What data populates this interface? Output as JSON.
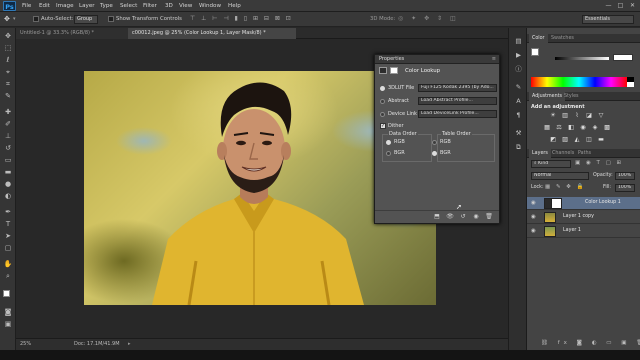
{
  "app": {
    "logo": "Ps"
  },
  "menu": [
    "File",
    "Edit",
    "Image",
    "Layer",
    "Type",
    "Select",
    "Filter",
    "3D",
    "View",
    "Window",
    "Help"
  ],
  "window_controls": {
    "minimize": "—",
    "maximize": "□",
    "close": "✕"
  },
  "options_bar": {
    "auto_select_label": "Auto-Select:",
    "auto_select_value": "Group",
    "show_transform_label": "Show Transform Controls",
    "mode_3d_label": "3D Mode:",
    "workspace": "Essentials"
  },
  "tabs": [
    {
      "label": "Untitled-1 @ 33.3% (RGB/8) *",
      "active": false
    },
    {
      "label": "c00012.jpeg @ 25% (Color Lookup 1, Layer Mask/8) *",
      "active": true
    }
  ],
  "status": {
    "zoom": "25%",
    "doc": "Doc: 17.1M/41.9M"
  },
  "properties": {
    "panel_tab": "Properties",
    "title": "Color Lookup",
    "rows": [
      {
        "label": "3DLUT File",
        "value": "Fuji F125 Kodak 2395 (by Ado...",
        "selected": true
      },
      {
        "label": "Abstract",
        "value": "Load Abstract Profile...",
        "selected": false
      },
      {
        "label": "Device Link",
        "value": "Load DeviceLink Profile...",
        "selected": false
      }
    ],
    "dither_label": "Dither",
    "data_order": {
      "title": "Data Order",
      "options": [
        "RGB",
        "BGR"
      ],
      "selected": "RGB"
    },
    "table_order": {
      "title": "Table Order",
      "options": [
        "RGB",
        "BGR"
      ],
      "selected": "BGR"
    }
  },
  "right_panels": {
    "color_tabs": [
      "Color",
      "Swatches"
    ],
    "adjust_tabs": [
      "Adjustments",
      "Styles"
    ],
    "add_adjustment_label": "Add an adjustment",
    "layers_tabs": [
      "Layers",
      "Channels",
      "Paths"
    ],
    "kind_label": "Kind",
    "blend_mode": "Normal",
    "opacity_label": "Opacity:",
    "opacity_value": "100%",
    "lock_label": "Lock:",
    "fill_label": "Fill:",
    "fill_value": "100%",
    "layers": [
      {
        "name": "Color Lookup 1",
        "selected": true
      },
      {
        "name": "Layer 1 copy",
        "selected": false
      },
      {
        "name": "Layer 1",
        "selected": false
      }
    ]
  },
  "colors": {
    "accent": "#5c6f8a",
    "ps_blue": "#34a3f5"
  }
}
